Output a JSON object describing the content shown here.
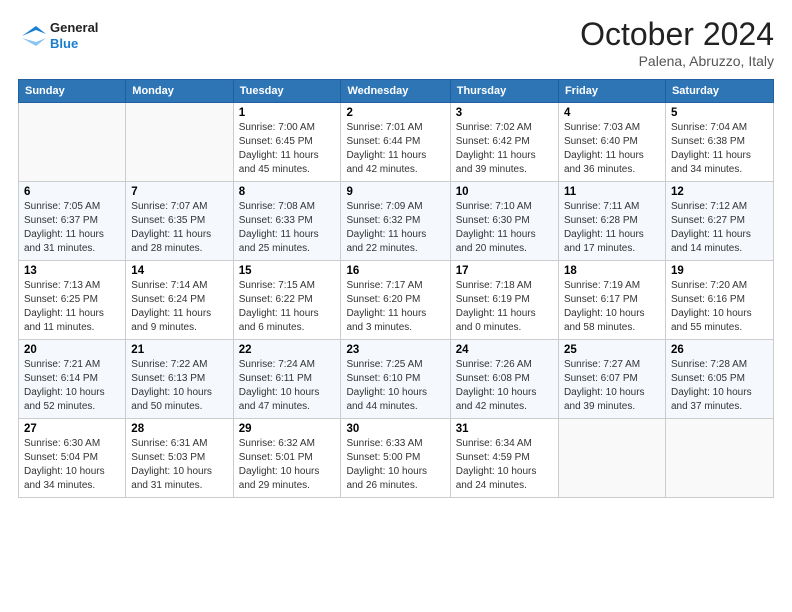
{
  "logo": {
    "general": "General",
    "blue": "Blue"
  },
  "title": {
    "month_year": "October 2024",
    "location": "Palena, Abruzzo, Italy"
  },
  "days_of_week": [
    "Sunday",
    "Monday",
    "Tuesday",
    "Wednesday",
    "Thursday",
    "Friday",
    "Saturday"
  ],
  "weeks": [
    [
      {
        "day": "",
        "sunrise": "",
        "sunset": "",
        "daylight": ""
      },
      {
        "day": "",
        "sunrise": "",
        "sunset": "",
        "daylight": ""
      },
      {
        "day": "1",
        "sunrise": "Sunrise: 7:00 AM",
        "sunset": "Sunset: 6:45 PM",
        "daylight": "Daylight: 11 hours and 45 minutes."
      },
      {
        "day": "2",
        "sunrise": "Sunrise: 7:01 AM",
        "sunset": "Sunset: 6:44 PM",
        "daylight": "Daylight: 11 hours and 42 minutes."
      },
      {
        "day": "3",
        "sunrise": "Sunrise: 7:02 AM",
        "sunset": "Sunset: 6:42 PM",
        "daylight": "Daylight: 11 hours and 39 minutes."
      },
      {
        "day": "4",
        "sunrise": "Sunrise: 7:03 AM",
        "sunset": "Sunset: 6:40 PM",
        "daylight": "Daylight: 11 hours and 36 minutes."
      },
      {
        "day": "5",
        "sunrise": "Sunrise: 7:04 AM",
        "sunset": "Sunset: 6:38 PM",
        "daylight": "Daylight: 11 hours and 34 minutes."
      }
    ],
    [
      {
        "day": "6",
        "sunrise": "Sunrise: 7:05 AM",
        "sunset": "Sunset: 6:37 PM",
        "daylight": "Daylight: 11 hours and 31 minutes."
      },
      {
        "day": "7",
        "sunrise": "Sunrise: 7:07 AM",
        "sunset": "Sunset: 6:35 PM",
        "daylight": "Daylight: 11 hours and 28 minutes."
      },
      {
        "day": "8",
        "sunrise": "Sunrise: 7:08 AM",
        "sunset": "Sunset: 6:33 PM",
        "daylight": "Daylight: 11 hours and 25 minutes."
      },
      {
        "day": "9",
        "sunrise": "Sunrise: 7:09 AM",
        "sunset": "Sunset: 6:32 PM",
        "daylight": "Daylight: 11 hours and 22 minutes."
      },
      {
        "day": "10",
        "sunrise": "Sunrise: 7:10 AM",
        "sunset": "Sunset: 6:30 PM",
        "daylight": "Daylight: 11 hours and 20 minutes."
      },
      {
        "day": "11",
        "sunrise": "Sunrise: 7:11 AM",
        "sunset": "Sunset: 6:28 PM",
        "daylight": "Daylight: 11 hours and 17 minutes."
      },
      {
        "day": "12",
        "sunrise": "Sunrise: 7:12 AM",
        "sunset": "Sunset: 6:27 PM",
        "daylight": "Daylight: 11 hours and 14 minutes."
      }
    ],
    [
      {
        "day": "13",
        "sunrise": "Sunrise: 7:13 AM",
        "sunset": "Sunset: 6:25 PM",
        "daylight": "Daylight: 11 hours and 11 minutes."
      },
      {
        "day": "14",
        "sunrise": "Sunrise: 7:14 AM",
        "sunset": "Sunset: 6:24 PM",
        "daylight": "Daylight: 11 hours and 9 minutes."
      },
      {
        "day": "15",
        "sunrise": "Sunrise: 7:15 AM",
        "sunset": "Sunset: 6:22 PM",
        "daylight": "Daylight: 11 hours and 6 minutes."
      },
      {
        "day": "16",
        "sunrise": "Sunrise: 7:17 AM",
        "sunset": "Sunset: 6:20 PM",
        "daylight": "Daylight: 11 hours and 3 minutes."
      },
      {
        "day": "17",
        "sunrise": "Sunrise: 7:18 AM",
        "sunset": "Sunset: 6:19 PM",
        "daylight": "Daylight: 11 hours and 0 minutes."
      },
      {
        "day": "18",
        "sunrise": "Sunrise: 7:19 AM",
        "sunset": "Sunset: 6:17 PM",
        "daylight": "Daylight: 10 hours and 58 minutes."
      },
      {
        "day": "19",
        "sunrise": "Sunrise: 7:20 AM",
        "sunset": "Sunset: 6:16 PM",
        "daylight": "Daylight: 10 hours and 55 minutes."
      }
    ],
    [
      {
        "day": "20",
        "sunrise": "Sunrise: 7:21 AM",
        "sunset": "Sunset: 6:14 PM",
        "daylight": "Daylight: 10 hours and 52 minutes."
      },
      {
        "day": "21",
        "sunrise": "Sunrise: 7:22 AM",
        "sunset": "Sunset: 6:13 PM",
        "daylight": "Daylight: 10 hours and 50 minutes."
      },
      {
        "day": "22",
        "sunrise": "Sunrise: 7:24 AM",
        "sunset": "Sunset: 6:11 PM",
        "daylight": "Daylight: 10 hours and 47 minutes."
      },
      {
        "day": "23",
        "sunrise": "Sunrise: 7:25 AM",
        "sunset": "Sunset: 6:10 PM",
        "daylight": "Daylight: 10 hours and 44 minutes."
      },
      {
        "day": "24",
        "sunrise": "Sunrise: 7:26 AM",
        "sunset": "Sunset: 6:08 PM",
        "daylight": "Daylight: 10 hours and 42 minutes."
      },
      {
        "day": "25",
        "sunrise": "Sunrise: 7:27 AM",
        "sunset": "Sunset: 6:07 PM",
        "daylight": "Daylight: 10 hours and 39 minutes."
      },
      {
        "day": "26",
        "sunrise": "Sunrise: 7:28 AM",
        "sunset": "Sunset: 6:05 PM",
        "daylight": "Daylight: 10 hours and 37 minutes."
      }
    ],
    [
      {
        "day": "27",
        "sunrise": "Sunrise: 6:30 AM",
        "sunset": "Sunset: 5:04 PM",
        "daylight": "Daylight: 10 hours and 34 minutes."
      },
      {
        "day": "28",
        "sunrise": "Sunrise: 6:31 AM",
        "sunset": "Sunset: 5:03 PM",
        "daylight": "Daylight: 10 hours and 31 minutes."
      },
      {
        "day": "29",
        "sunrise": "Sunrise: 6:32 AM",
        "sunset": "Sunset: 5:01 PM",
        "daylight": "Daylight: 10 hours and 29 minutes."
      },
      {
        "day": "30",
        "sunrise": "Sunrise: 6:33 AM",
        "sunset": "Sunset: 5:00 PM",
        "daylight": "Daylight: 10 hours and 26 minutes."
      },
      {
        "day": "31",
        "sunrise": "Sunrise: 6:34 AM",
        "sunset": "Sunset: 4:59 PM",
        "daylight": "Daylight: 10 hours and 24 minutes."
      },
      {
        "day": "",
        "sunrise": "",
        "sunset": "",
        "daylight": ""
      },
      {
        "day": "",
        "sunrise": "",
        "sunset": "",
        "daylight": ""
      }
    ]
  ]
}
